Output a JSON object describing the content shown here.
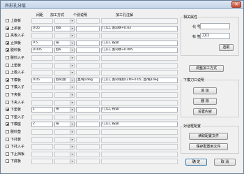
{
  "window": {
    "title": "异形孔分层"
  },
  "columns": {
    "depth": "间距",
    "method": "加工方式",
    "desc": "个别说明",
    "note": "加工孔注解"
  },
  "rows": [
    {
      "label": "上旋板",
      "checked": false,
      "depth": "",
      "method": "",
      "desc": "",
      "note": "",
      "enabled": false
    },
    {
      "label": "上吊板",
      "checked": true,
      "depth": "0.05",
      "method": "割a",
      "desc": "",
      "note": "(刀口, 割a)精+0.03",
      "enabled": true
    },
    {
      "label": "夹板入子",
      "checked": false,
      "depth": "",
      "method": "",
      "desc": "",
      "note": "",
      "enabled": false
    },
    {
      "label": "止挡板",
      "checked": true,
      "depth": "0.5",
      "method": "铣",
      "desc": "",
      "note": "(刀口, 铣穿)",
      "enabled": true
    },
    {
      "label": "脱料板",
      "checked": true,
      "depth": "0.005",
      "method": "割a",
      "desc": "",
      "note": "(刀口, 割a)精+0.005",
      "enabled": true
    },
    {
      "label": "脱料入子",
      "checked": false,
      "depth": "",
      "method": "",
      "desc": "",
      "note": "",
      "enabled": false
    },
    {
      "label": "上垫板",
      "checked": false,
      "depth": "",
      "method": "",
      "desc": "",
      "note": "",
      "enabled": false
    },
    {
      "label": "上模入子",
      "checked": false,
      "depth": "",
      "method": "",
      "desc": "",
      "note": "",
      "enabled": false
    },
    {
      "label": "下模板",
      "checked": true,
      "depth": "0.05",
      "method": "割a(割)",
      "desc": "直/缩1deg",
      "note": "(刀口, 割a)线割12单+0.05, 直/缩1deg",
      "enabled": true
    },
    {
      "label": "下模入子",
      "checked": false,
      "depth": "",
      "method": "",
      "desc": "",
      "note": "",
      "enabled": false
    },
    {
      "label": "下夹板",
      "checked": false,
      "depth": "",
      "method": "",
      "desc": "",
      "note": "",
      "enabled": false
    },
    {
      "label": "下夹入子",
      "checked": false,
      "depth": "",
      "method": "",
      "desc": "",
      "note": "",
      "enabled": false
    },
    {
      "label": "下垫板",
      "checked": true,
      "depth": "1",
      "method": "铣",
      "desc": "",
      "note": "(刀口, 铣穿)",
      "enabled": true
    },
    {
      "label": "下垫入子",
      "checked": false,
      "depth": "",
      "method": "",
      "desc": "",
      "note": "",
      "enabled": false
    },
    {
      "label": "下模座",
      "checked": true,
      "depth": "2",
      "method": "铣",
      "desc": "",
      "note": "(刀口, 铣穿)",
      "enabled": true
    },
    {
      "label": "脱料垫",
      "checked": false,
      "depth": "",
      "method": "",
      "desc": "",
      "note": "",
      "enabled": false
    },
    {
      "label": "下托板",
      "checked": false,
      "depth": "",
      "method": "",
      "desc": "",
      "note": "",
      "enabled": false
    },
    {
      "label": "下托入子",
      "checked": false,
      "depth": "",
      "method": "",
      "desc": "",
      "note": "",
      "enabled": false
    },
    {
      "label": "下止挡板",
      "checked": false,
      "depth": "",
      "method": "",
      "desc": "",
      "note": "",
      "enabled": false
    },
    {
      "label": "下底板",
      "checked": false,
      "depth": "",
      "method": "",
      "desc": "",
      "note": "",
      "enabled": false
    }
  ],
  "props": {
    "group_title": "相关属性",
    "code_label": "代 号",
    "code_value": "",
    "mark_label": "标 签",
    "mark_value": "刀口",
    "select_button": "选取"
  },
  "process_button": "调整加工方式",
  "sub_group": {
    "title": "下模刀口说明",
    "add": "追 加",
    "delete": "删 除",
    "settings": "设置内容"
  },
  "config_group": {
    "title": "对话框配置",
    "read": "读取配置文件",
    "save": "保存配置到文件"
  },
  "footer": {
    "ok": "确 定",
    "cancel": "取 消"
  },
  "colors": {
    "window_border": "#6b7f96",
    "titlebar": "#c4d5e9",
    "close": "#c6452a"
  }
}
